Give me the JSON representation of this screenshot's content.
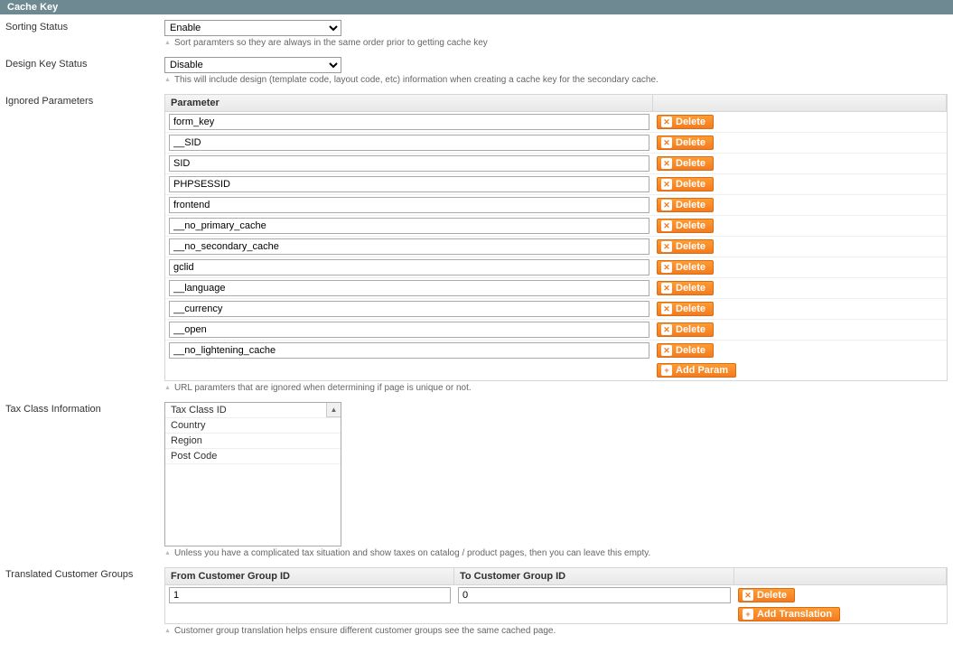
{
  "header": {
    "title": "Cache Key"
  },
  "sorting_status": {
    "label": "Sorting Status",
    "value": "Enable",
    "hint": "Sort paramters so they are always in the same order prior to getting cache key"
  },
  "design_key_status": {
    "label": "Design Key Status",
    "value": "Disable",
    "hint": "This will include design (template code, layout code, etc) information when creating a cache key for the secondary cache."
  },
  "ignored_params": {
    "label": "Ignored Parameters",
    "header": "Parameter",
    "items": [
      "form_key",
      "__SID",
      "SID",
      "PHPSESSID",
      "frontend",
      "__no_primary_cache",
      "__no_secondary_cache",
      "gclid",
      "__language",
      "__currency",
      "__open",
      "__no_lightening_cache"
    ],
    "delete_label": "Delete",
    "add_label": "Add Param",
    "hint": "URL paramters that are ignored when determining if page is unique or not."
  },
  "tax_class": {
    "label": "Tax Class Information",
    "options": [
      "Tax Class ID",
      "Country",
      "Region",
      "Post Code"
    ],
    "hint": "Unless you have a complicated tax situation and show taxes on catalog / product pages, then you can leave this empty."
  },
  "translated_groups": {
    "label": "Translated Customer Groups",
    "from_header": "From Customer Group ID",
    "to_header": "To Customer Group ID",
    "rows": [
      {
        "from": "1",
        "to": "0"
      }
    ],
    "delete_label": "Delete",
    "add_label": "Add Translation",
    "hint": "Customer group translation helps ensure different customer groups see the same cached page."
  }
}
